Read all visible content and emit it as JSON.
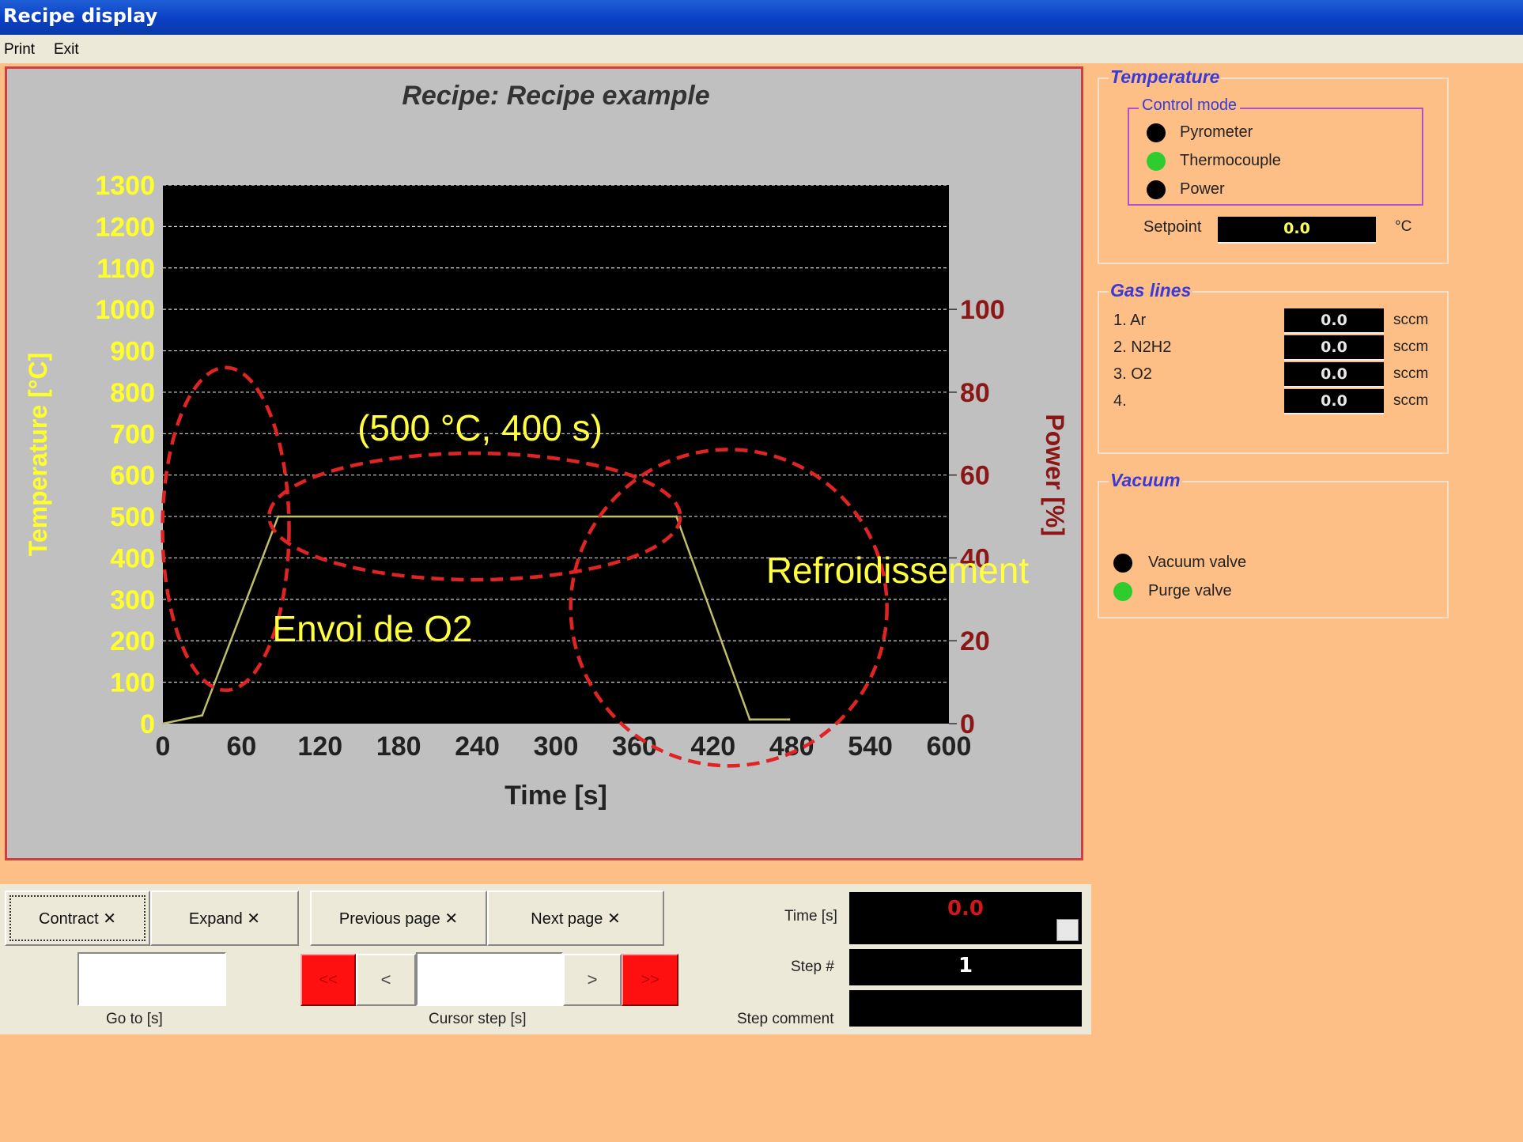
{
  "window": {
    "title": "Recipe display"
  },
  "menu": {
    "print": "Print",
    "exit": "Exit"
  },
  "chart_data": {
    "type": "line",
    "title": "Recipe: Recipe example",
    "xlabel": "Time  [s]",
    "ylabel": "Temperature  [°C]",
    "y2label": "Power  [%]",
    "xlim": [
      0,
      600
    ],
    "ylim": [
      0,
      1300
    ],
    "y2lim": [
      0,
      130
    ],
    "xticks": [
      0,
      60,
      120,
      180,
      240,
      300,
      360,
      420,
      480,
      540,
      600
    ],
    "yticks": [
      0,
      100,
      200,
      300,
      400,
      500,
      600,
      700,
      800,
      900,
      1000,
      1100,
      1200,
      1300
    ],
    "y2ticks": [
      0,
      20,
      40,
      60,
      80,
      100
    ],
    "grid": true,
    "series": [
      {
        "x": [
          0,
          30,
          88,
          392,
          448,
          478
        ],
        "y": [
          0,
          20,
          500,
          500,
          10,
          10
        ]
      }
    ],
    "annotations": [
      {
        "text": "(500 °C, 400 s)",
        "color": "#ffff40"
      },
      {
        "text": "Envoi de O2",
        "color": "#ffff40"
      },
      {
        "text": "Refroidissement",
        "color": "#ffff40"
      }
    ]
  },
  "colors": {
    "temperature_axis": "#ffff2a",
    "power_axis": "#8b1616",
    "trace": "#bfbf6a",
    "annotation_ellipse": "#e02424"
  },
  "temperature": {
    "legend": "Temperature",
    "control_mode_legend": "Control mode",
    "modes": [
      {
        "label": "Pyrometer",
        "color": "#000000"
      },
      {
        "label": "Thermocouple",
        "color": "#2ecc2e"
      },
      {
        "label": "Power",
        "color": "#000000"
      }
    ],
    "setpoint_label": "Setpoint",
    "setpoint_value": "0.0",
    "setpoint_unit": "°C"
  },
  "gas_lines": {
    "legend": "Gas lines",
    "items": [
      {
        "label": "1. Ar",
        "value": "0.0",
        "unit": "sccm"
      },
      {
        "label": "2. N2H2",
        "value": "0.0",
        "unit": "sccm"
      },
      {
        "label": "3. O2",
        "value": "0.0",
        "unit": "sccm"
      },
      {
        "label": "4.",
        "value": "0.0",
        "unit": "sccm"
      }
    ]
  },
  "vacuum": {
    "legend": "Vacuum",
    "items": [
      {
        "label": "Vacuum valve",
        "color": "#000000"
      },
      {
        "label": "Purge valve",
        "color": "#2ecc2e"
      }
    ]
  },
  "controls": {
    "contract": "Contract ✕",
    "expand": "Expand ✕",
    "previous_page": "Previous  page ✕",
    "next_page": "Next page ✕",
    "goto_label": "Go to [s]",
    "goto_value": "",
    "cursor_step_label": "Cursor step [s]",
    "cursor_step_value": "",
    "rewind_glyph": "<<",
    "back_glyph": "<",
    "forward_glyph": ">",
    "fast_forward_glyph": ">>",
    "time_label": "Time [s]",
    "time_value": "0.0",
    "step_label": "Step #",
    "step_value": "1",
    "step_comment_label": "Step comment",
    "step_comment_value": ""
  }
}
